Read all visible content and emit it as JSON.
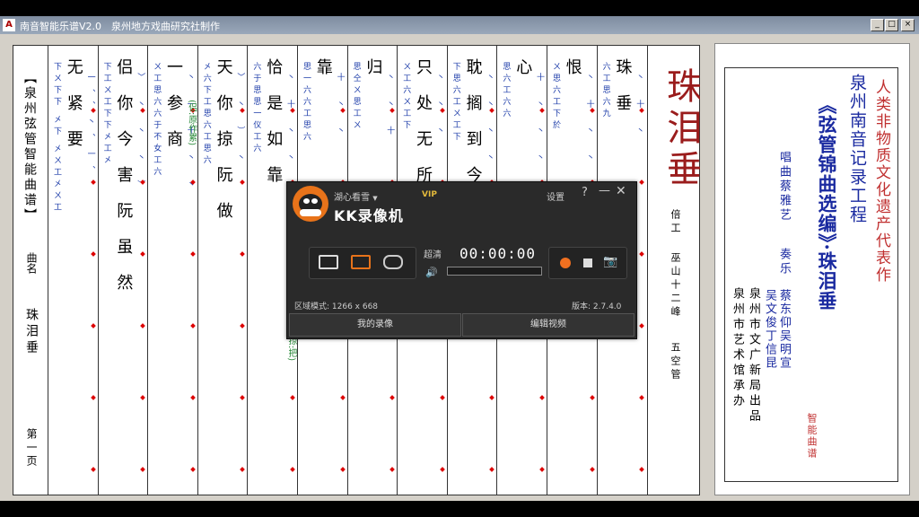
{
  "window": {
    "title": "南音智能乐谱V2.0",
    "producer": "泉州地方戏曲研究社制作",
    "btn_min": "_",
    "btn_max": "□",
    "btn_close": "×"
  },
  "score": {
    "side_title": "【泉州弦管智能曲谱】",
    "qu_ming_label": "曲名",
    "qu_ming": "珠泪垂",
    "page": "第一页",
    "columns": [
      {
        "lyrics": "无紧要",
        "left": "下ㄨ下下 㐅下 㐅ㄨ工㐅ㄨ工",
        "right": "一、、丶、一、"
      },
      {
        "lyrics": "侣你今害阮虽然",
        "left": "下工ㄨ工下下㐅工㐅",
        "right": "〉 丶 丶 丶 ）"
      },
      {
        "lyrics": "一参商",
        "left": "ㄨ工思六六于不女工六",
        "right": "丶 一 十 丶 丶"
      },
      {
        "lyrics": "天你掠阮做",
        "left": "㐅六下工思六工思六",
        "right": "〉 丶 ） 丶"
      },
      {
        "lyrics": "恰是如靠",
        "left": "六于思思一仪工六",
        "right": "丶 十 丶 丶"
      },
      {
        "lyrics": "靠",
        "left": "思一六六工思六",
        "right": "十 丶 丶"
      },
      {
        "lyrics": "归",
        "left": "思仝ㄨ思工ㄨ",
        "right": "丶 丶 十"
      },
      {
        "lyrics": "只处无所",
        "left": "ㄨ工六ㄨ工下",
        "right": "丶 丶 丶"
      },
      {
        "lyrics": "耽搁到今旦",
        "left": "下思六工ㄨ工下",
        "right": "丶 丶 丶 丶"
      },
      {
        "lyrics": "心",
        "left": "思六工六六",
        "right": "十 丶 丶 丶"
      },
      {
        "lyrics": "恨",
        "left": "ㄨ思六工下於",
        "right": "丶 十 丶 丶"
      },
      {
        "lyrics": "珠垂",
        "left": "六工思六九",
        "right": "丶 十 丶"
      }
    ],
    "song_title": "珠泪垂",
    "meta_left": "倍工",
    "meta_mid": "巫山十二峰",
    "meta_right": "五空管",
    "paren_notes": [
      "(侣:原作累)",
      "(掠:把)"
    ]
  },
  "panel": {
    "line1": "人类非物质文化遗产代表作",
    "line2": "泉州南音记录工程",
    "line3": "《弦管锦曲选编》·珠泪垂",
    "singer": "唱曲蔡雅艺",
    "players_label": "奏乐",
    "players1": "蔡东仰吴明宣",
    "players2": "吴文俊丁信昆",
    "pub1": "泉州市文广新局出品",
    "pub2": "泉州市艺术馆承办",
    "stamp": "智能曲谱"
  },
  "recorder": {
    "user": "湖心看雪",
    "user_arrow": "▼",
    "vip": "VIP",
    "brand": "KK录像机",
    "settings": "设置",
    "help": "?",
    "minimize": "—",
    "close": "✕",
    "quality": "超清",
    "volume_icon": "🔊",
    "timer": "00:00:00",
    "area": "区域模式: 1266 x 668",
    "version": "版本: 2.7.4.0",
    "my_recordings": "我的录像",
    "edit_video": "编辑视频",
    "camera_icon": "📷",
    "progress": 0
  }
}
